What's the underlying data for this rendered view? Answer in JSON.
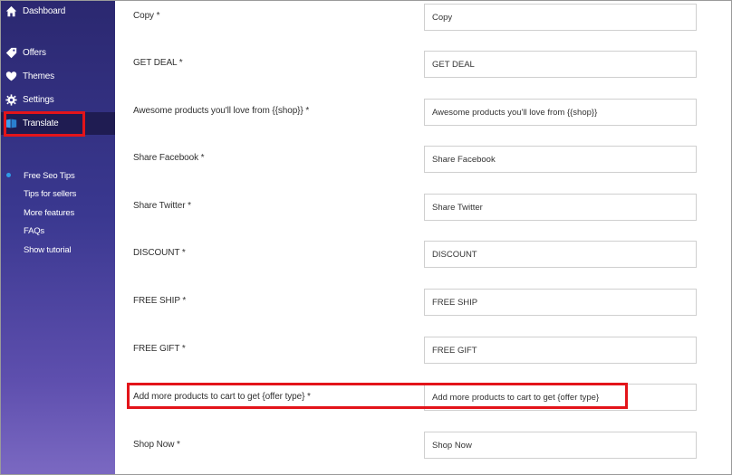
{
  "sidebar": {
    "nav": [
      {
        "label": "Dashboard",
        "icon": "home-icon"
      },
      {
        "label": "Offers",
        "icon": "tag-icon"
      },
      {
        "label": "Themes",
        "icon": "heart-icon"
      },
      {
        "label": "Settings",
        "icon": "gear-icon"
      },
      {
        "label": "Translate",
        "icon": "translate-icon",
        "active": true
      }
    ],
    "secondary": [
      {
        "label": "Free Seo Tips",
        "bullet": true
      },
      {
        "label": "Tips for sellers"
      },
      {
        "label": "More features"
      },
      {
        "label": "FAQs"
      },
      {
        "label": "Show tutorial"
      }
    ]
  },
  "form": {
    "rows": [
      {
        "label": "Copy *",
        "value": "Copy"
      },
      {
        "label": "GET DEAL *",
        "value": "GET DEAL"
      },
      {
        "label": "Awesome products you'll love from {{shop}} *",
        "value": "Awesome products you'll love from {{shop}}"
      },
      {
        "label": "Share Facebook *",
        "value": "Share Facebook"
      },
      {
        "label": "Share Twitter *",
        "value": "Share Twitter"
      },
      {
        "label": "DISCOUNT *",
        "value": "DISCOUNT"
      },
      {
        "label": "FREE SHIP *",
        "value": "FREE SHIP"
      },
      {
        "label": "FREE GIFT *",
        "value": "FREE GIFT"
      },
      {
        "label": "Add more products to cart to get {offer type} *",
        "value": "Add more products to cart to get {offer type}"
      },
      {
        "label": "Shop Now *",
        "value": "Shop Now"
      }
    ]
  },
  "colors": {
    "sidebar_top": "#2b2870",
    "sidebar_bottom": "#7b69c2",
    "highlight": "#e3141a",
    "active_nav": "#1f1c52"
  }
}
